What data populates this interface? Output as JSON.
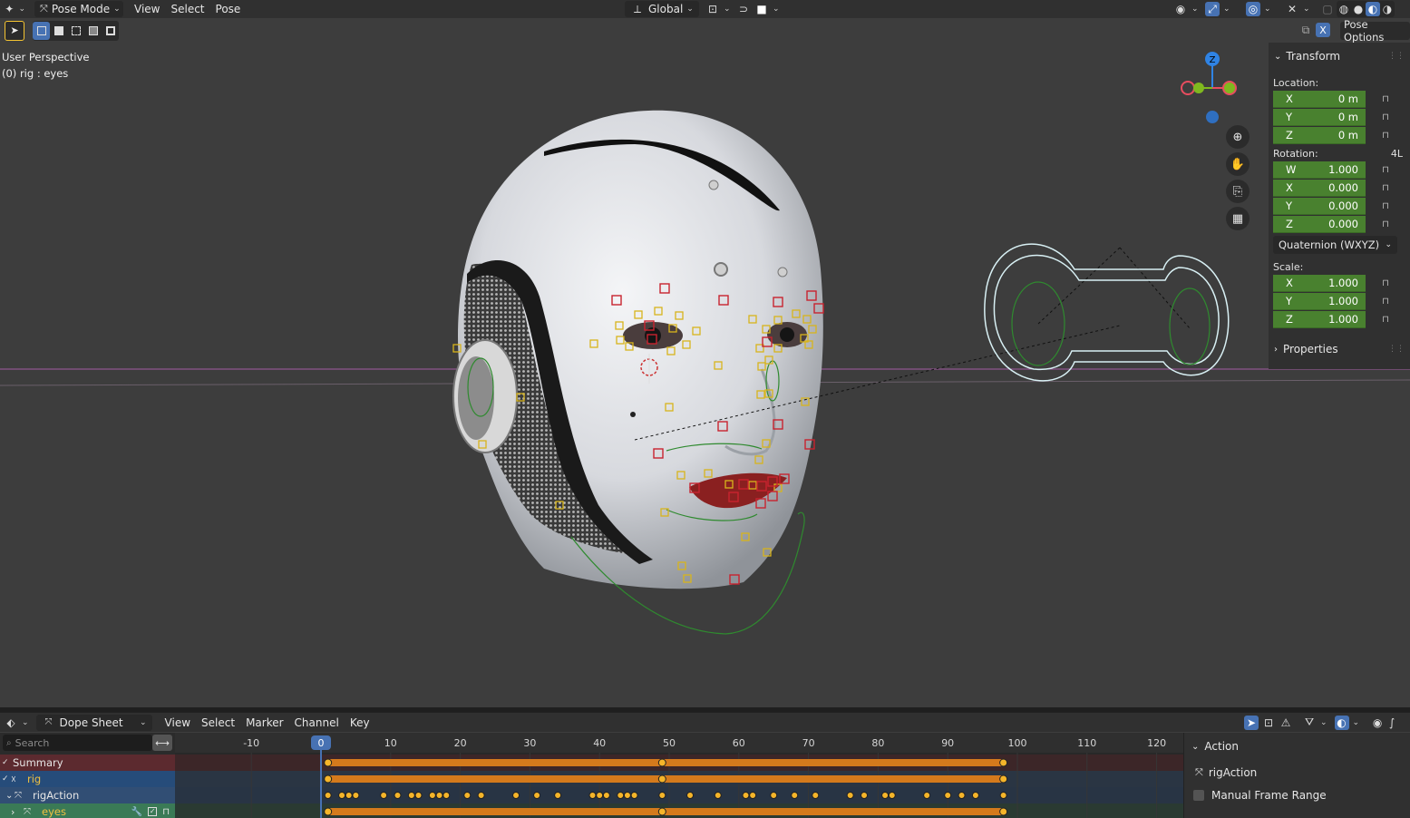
{
  "header": {
    "mode": "Pose Mode",
    "menus": [
      "View",
      "Select",
      "Pose"
    ],
    "transform_orientation": "Global",
    "pose_options": "Pose Options",
    "x_mirror": "X"
  },
  "viewport": {
    "perspective": "User Perspective",
    "object_info": "(0) rig : eyes",
    "gizmo": {
      "z_label": "Z"
    }
  },
  "transform_panel": {
    "title": "Transform",
    "location_label": "Location:",
    "location": [
      {
        "axis": "X",
        "value": "0 m"
      },
      {
        "axis": "Y",
        "value": "0 m"
      },
      {
        "axis": "Z",
        "value": "0 m"
      }
    ],
    "rotation_label": "Rotation:",
    "rotation_lock_mode": "4L",
    "rotation": [
      {
        "axis": "W",
        "value": "1.000"
      },
      {
        "axis": "X",
        "value": "0.000"
      },
      {
        "axis": "Y",
        "value": "0.000"
      },
      {
        "axis": "Z",
        "value": "0.000"
      }
    ],
    "rotation_mode": "Quaternion (WXYZ)",
    "scale_label": "Scale:",
    "scale": [
      {
        "axis": "X",
        "value": "1.000"
      },
      {
        "axis": "Y",
        "value": "1.000"
      },
      {
        "axis": "Z",
        "value": "1.000"
      }
    ],
    "properties_label": "Properties"
  },
  "dopesheet": {
    "editor_type": "Dope Sheet",
    "menus": [
      "View",
      "Select",
      "Marker",
      "Channel",
      "Key"
    ],
    "search_placeholder": "Search",
    "current_frame": "0",
    "ruler_ticks": [
      "-10",
      "10",
      "20",
      "30",
      "40",
      "50",
      "60",
      "70",
      "80",
      "90",
      "100",
      "110",
      "120"
    ],
    "channels": [
      {
        "name": "Summary"
      },
      {
        "name": "rig"
      },
      {
        "name": "rigAction"
      },
      {
        "name": "eyes"
      }
    ],
    "sidebar": {
      "panel_title": "Action",
      "action_name": "rigAction",
      "manual_frame_range": "Manual Frame Range"
    }
  },
  "colors": {
    "accent": "#4772b3",
    "field_green": "#49812f",
    "keyframe": "#f5b52a",
    "summary_bar": "#d47a1c",
    "gizmo_x": "#e84d5f",
    "gizmo_y": "#7fb81f",
    "gizmo_z": "#2f83e4"
  }
}
